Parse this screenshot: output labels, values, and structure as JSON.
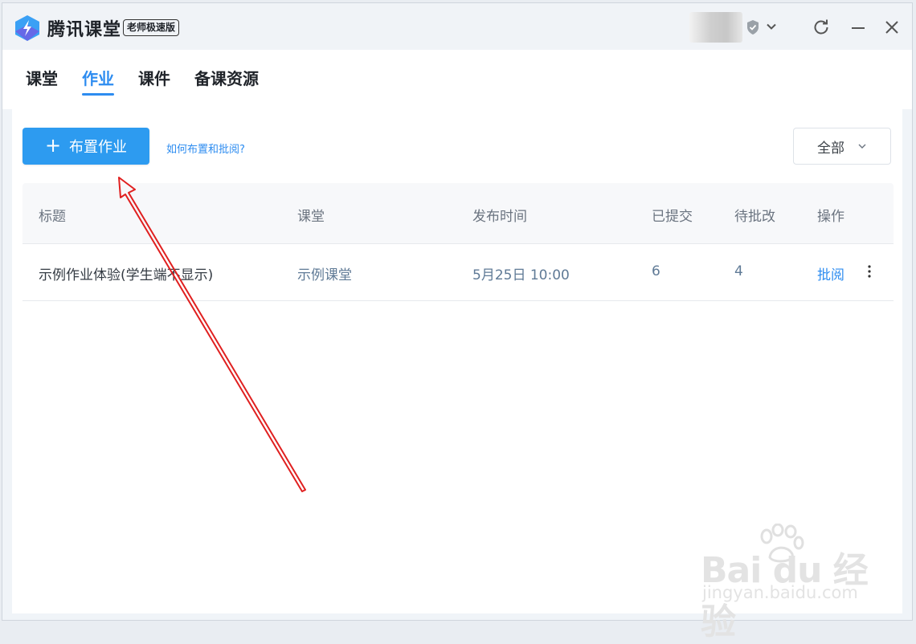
{
  "titlebar": {
    "app_name": "腾讯课堂",
    "edition_badge": "老师极速版"
  },
  "nav": {
    "tabs": [
      {
        "label": "课堂",
        "active": false
      },
      {
        "label": "作业",
        "active": true
      },
      {
        "label": "课件",
        "active": false
      },
      {
        "label": "备课资源",
        "active": false
      }
    ]
  },
  "toolbar": {
    "assign_label": "布置作业",
    "help_link": "如何布置和批阅?",
    "filter_value": "全部"
  },
  "table": {
    "headers": [
      "标题",
      "课堂",
      "发布时间",
      "已提交",
      "待批改",
      "操作"
    ],
    "rows": [
      {
        "title": "示例作业体验(学生端不显示)",
        "class": "示例课堂",
        "publish_time": "5月25日 10:00",
        "submitted": "6",
        "pending": "4",
        "action": "批阅"
      }
    ]
  },
  "watermark": {
    "brand": "Bai du 经验",
    "url": "jingyan.baidu.com"
  },
  "colors": {
    "accent": "#2d8cf0",
    "button": "#2d9bf0",
    "annotation_arrow": "#e02020"
  },
  "icons": [
    "app-logo-icon",
    "shield-icon",
    "chevron-down-icon",
    "refresh-icon",
    "minimize-icon",
    "close-icon",
    "plus-icon",
    "more-vertical-icon"
  ]
}
